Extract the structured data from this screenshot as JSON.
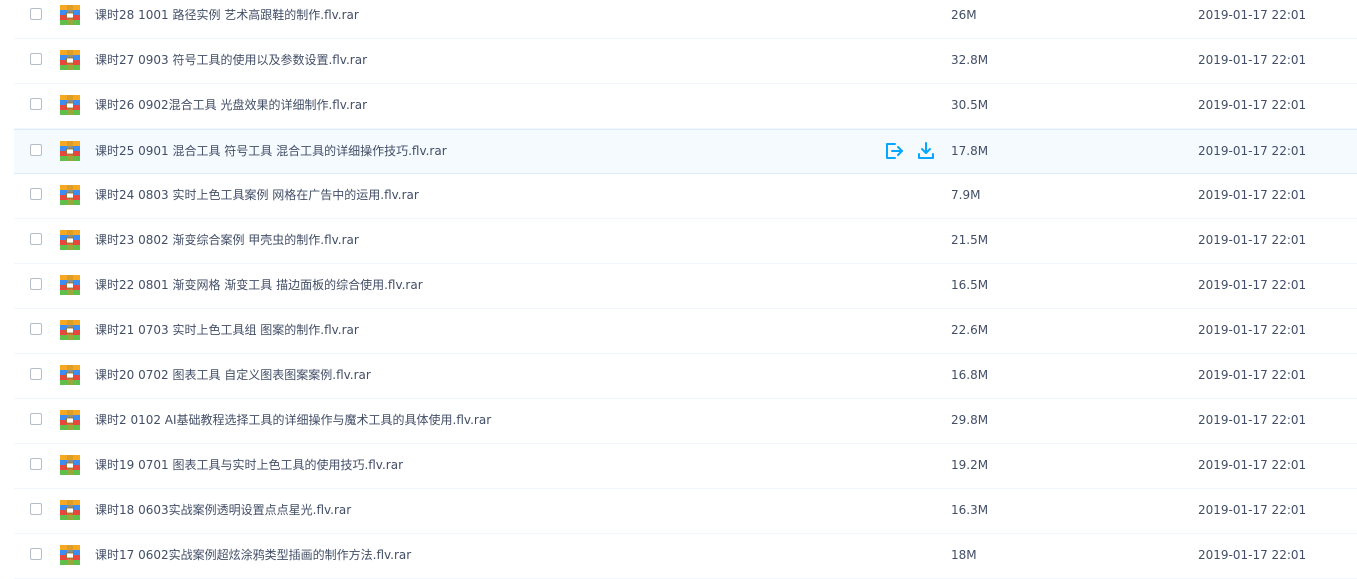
{
  "colors": {
    "accent": "#06a7ff",
    "text": "#424e67",
    "row_divider": "#f2f6fd",
    "hover_bg": "#f5faff"
  },
  "file_icon": "rar-archive-icon",
  "row_actions": {
    "share_icon": "share-icon",
    "download_icon": "download-icon"
  },
  "files": [
    {
      "name": "课时28 1001 路径实例 艺术高跟鞋的制作.flv.rar",
      "size": "26M",
      "modified": "2019-01-17 22:01"
    },
    {
      "name": "课时27 0903 符号工具的使用以及参数设置.flv.rar",
      "size": "32.8M",
      "modified": "2019-01-17 22:01"
    },
    {
      "name": "课时26 0902混合工具 光盘效果的详细制作.flv.rar",
      "size": "30.5M",
      "modified": "2019-01-17 22:01"
    },
    {
      "name": "课时25 0901 混合工具 符号工具 混合工具的详细操作技巧.flv.rar",
      "size": "17.8M",
      "modified": "2019-01-17 22:01"
    },
    {
      "name": "课时24 0803 实时上色工具案例 网格在广告中的运用.flv.rar",
      "size": "7.9M",
      "modified": "2019-01-17 22:01"
    },
    {
      "name": "课时23 0802 渐变综合案例 甲壳虫的制作.flv.rar",
      "size": "21.5M",
      "modified": "2019-01-17 22:01"
    },
    {
      "name": "课时22 0801 渐变网格 渐变工具 描边面板的综合使用.flv.rar",
      "size": "16.5M",
      "modified": "2019-01-17 22:01"
    },
    {
      "name": "课时21 0703 实时上色工具组 图案的制作.flv.rar",
      "size": "22.6M",
      "modified": "2019-01-17 22:01"
    },
    {
      "name": "课时20 0702 图表工具 自定义图表图案案例.flv.rar",
      "size": "16.8M",
      "modified": "2019-01-17 22:01"
    },
    {
      "name": "课时2 0102 AI基础教程选择工具的详细操作与魔术工具的具体使用.flv.rar",
      "size": "29.8M",
      "modified": "2019-01-17 22:01"
    },
    {
      "name": "课时19 0701 图表工具与实时上色工具的使用技巧.flv.rar",
      "size": "19.2M",
      "modified": "2019-01-17 22:01"
    },
    {
      "name": "课时18 0603实战案例透明设置点点星光.flv.rar",
      "size": "16.3M",
      "modified": "2019-01-17 22:01"
    },
    {
      "name": "课时17 0602实战案例超炫涂鸦类型插画的制作方法.flv.rar",
      "size": "18M",
      "modified": "2019-01-17 22:01"
    }
  ]
}
